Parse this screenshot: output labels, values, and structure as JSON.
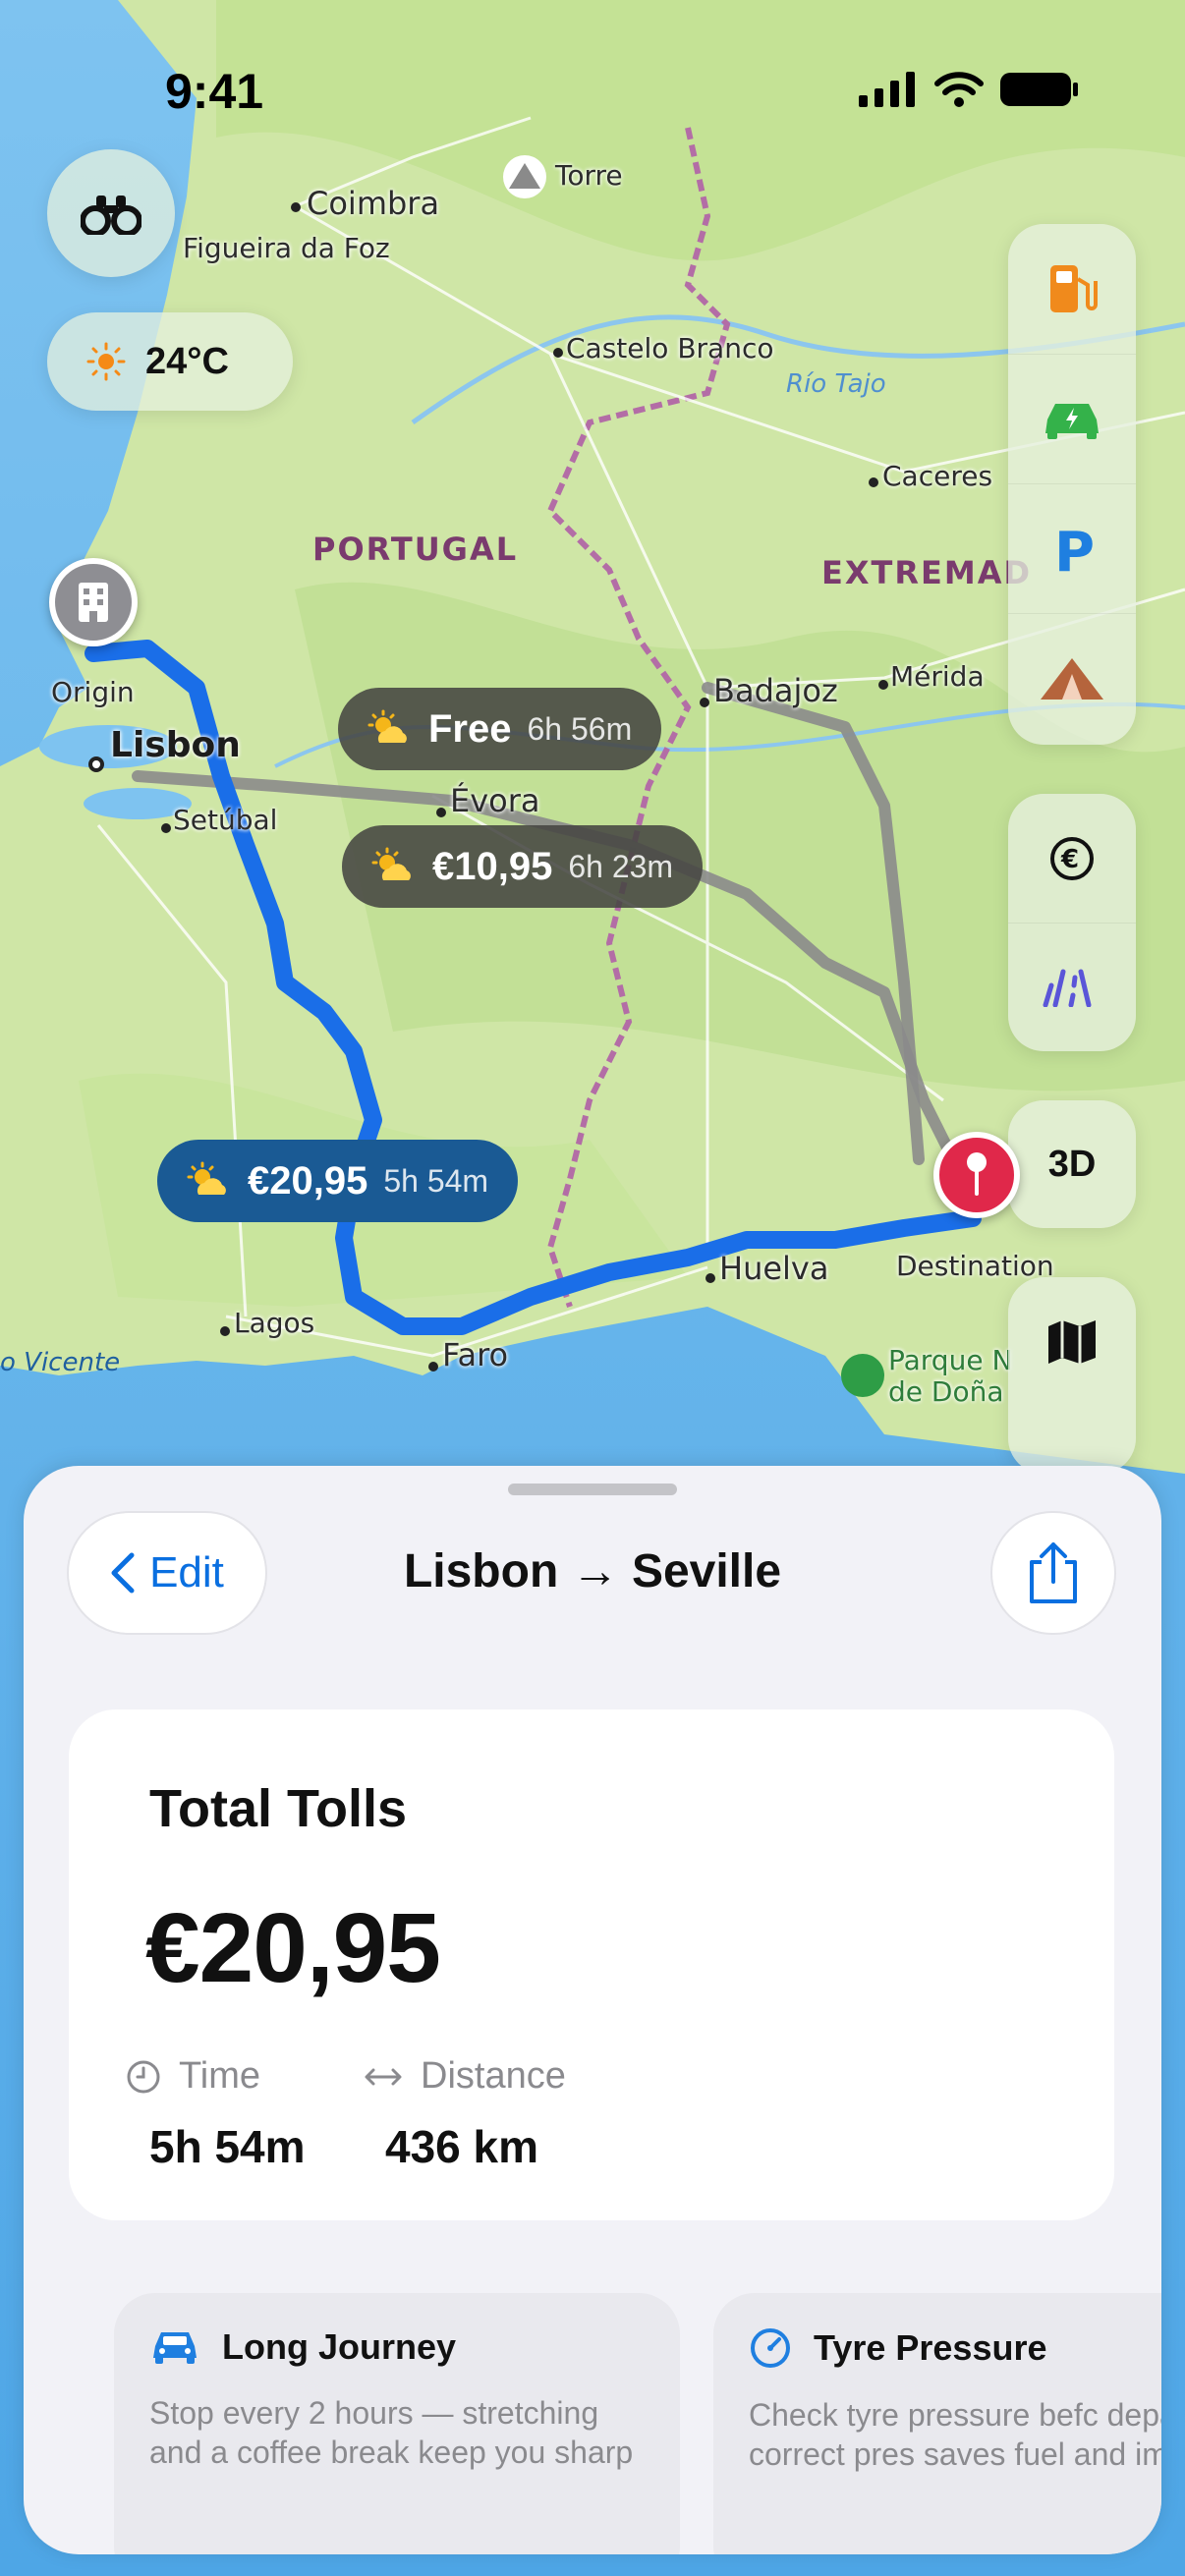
{
  "status_bar": {
    "time": "9:41"
  },
  "weather_chip": {
    "temperature": "24°C"
  },
  "map": {
    "labels": {
      "torre": "Torre",
      "coimbra": "Coimbra",
      "figueira": "Figueira da Foz",
      "castelo_branco": "Castelo Branco",
      "rio_tajo": "Río Tajo",
      "caceres": "Caceres",
      "portugal": "PORTUGAL",
      "extremadura": "EXTREMAD",
      "origin": "Origin",
      "lisbon": "Lisbon",
      "badajoz": "Badajoz",
      "merida": "Mérida",
      "setubal": "Setúbal",
      "evora": "Évora",
      "huelva": "Huelva",
      "destination": "Destination",
      "lagos": "Lagos",
      "faro": "Faro",
      "vicente": "o Vicente",
      "parque": "Parque N",
      "donana": "de Doña"
    }
  },
  "routes": [
    {
      "price": "Free",
      "duration": "6h 56m",
      "selected": false
    },
    {
      "price": "€10,95",
      "duration": "6h 23m",
      "selected": false
    },
    {
      "price": "€20,95",
      "duration": "5h 54m",
      "selected": true
    }
  ],
  "right_rail": {
    "three_d_label": "3D"
  },
  "sheet": {
    "edit_label": "Edit",
    "title": "Lisbon → Seville",
    "summary": {
      "heading": "Total Tolls",
      "amount": "€20,95",
      "time_label": "Time",
      "time_value": "5h 54m",
      "distance_label": "Distance",
      "distance_value": "436 km"
    },
    "tips": [
      {
        "title": "Long Journey",
        "body": "Stop every 2 hours — stretching and a coffee break keep you sharp"
      },
      {
        "title": "Tyre Pressure",
        "body": "Check tyre pressure befc departure — correct pres saves fuel and improves"
      }
    ]
  },
  "colors": {
    "accent": "#0a6fe0",
    "route_selected": "#1a6ee8",
    "route_alt": "#8b8b8b",
    "destination_pin": "#e0284a",
    "fuel_icon": "#f08a1c",
    "ev_icon": "#34b24a",
    "parking_icon": "#1f7fe0",
    "camp_icon": "#b5643c",
    "speed_icon": "#5a55d8"
  }
}
